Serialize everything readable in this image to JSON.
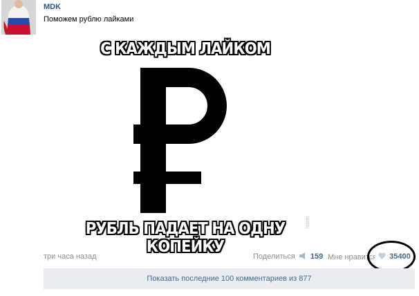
{
  "post": {
    "author": "MDK",
    "text": "Поможем рублю лайками",
    "time": "три часа назад"
  },
  "meme": {
    "top_text": "С КАЖДЫМ ЛАЙКОМ",
    "bottom_text": "РУБЛЬ ПАДАЕТ НА ОДНУ КОПЕЙКУ",
    "symbol": "ruble-sign",
    "watermark": "lorem"
  },
  "actions": {
    "share_label": "Поделиться",
    "share_count": "159",
    "like_label": "Мне нравится",
    "like_count": "35400",
    "icons": {
      "share": "megaphone-icon",
      "like": "heart-icon"
    }
  },
  "comments": {
    "show_label": "Показать последние 100 комментариев из 877"
  },
  "colors": {
    "link": "#2b587a",
    "accent": "#45688e",
    "muted": "#8c8c8c",
    "bar": "#e9edf1"
  }
}
